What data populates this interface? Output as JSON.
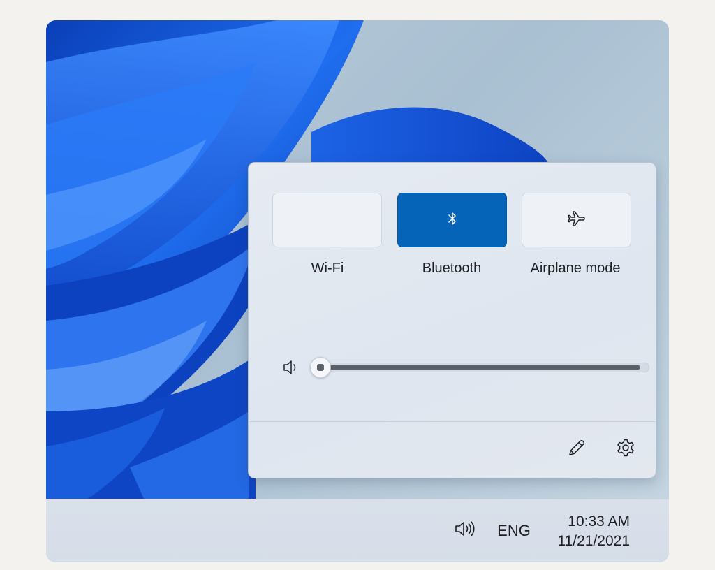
{
  "quick_settings": {
    "tiles": [
      {
        "label": "Wi-Fi",
        "state": "off",
        "icon": "wifi-icon"
      },
      {
        "label": "Bluetooth",
        "state": "on",
        "icon": "bluetooth-icon"
      },
      {
        "label": "Airplane mode",
        "state": "off",
        "icon": "airplane-icon"
      }
    ],
    "volume": {
      "icon": "speaker-low-icon",
      "level": 0
    },
    "footer": {
      "edit_icon": "pencil-icon",
      "settings_icon": "gear-icon"
    }
  },
  "taskbar": {
    "volume_icon": "speaker-high-icon",
    "language": "ENG",
    "time": "10:33 AM",
    "date": "11/21/2021"
  },
  "colors": {
    "accent": "#0563b8",
    "tile_off": "#eef1f5",
    "wallpaper_blue": "#1a55d8"
  }
}
